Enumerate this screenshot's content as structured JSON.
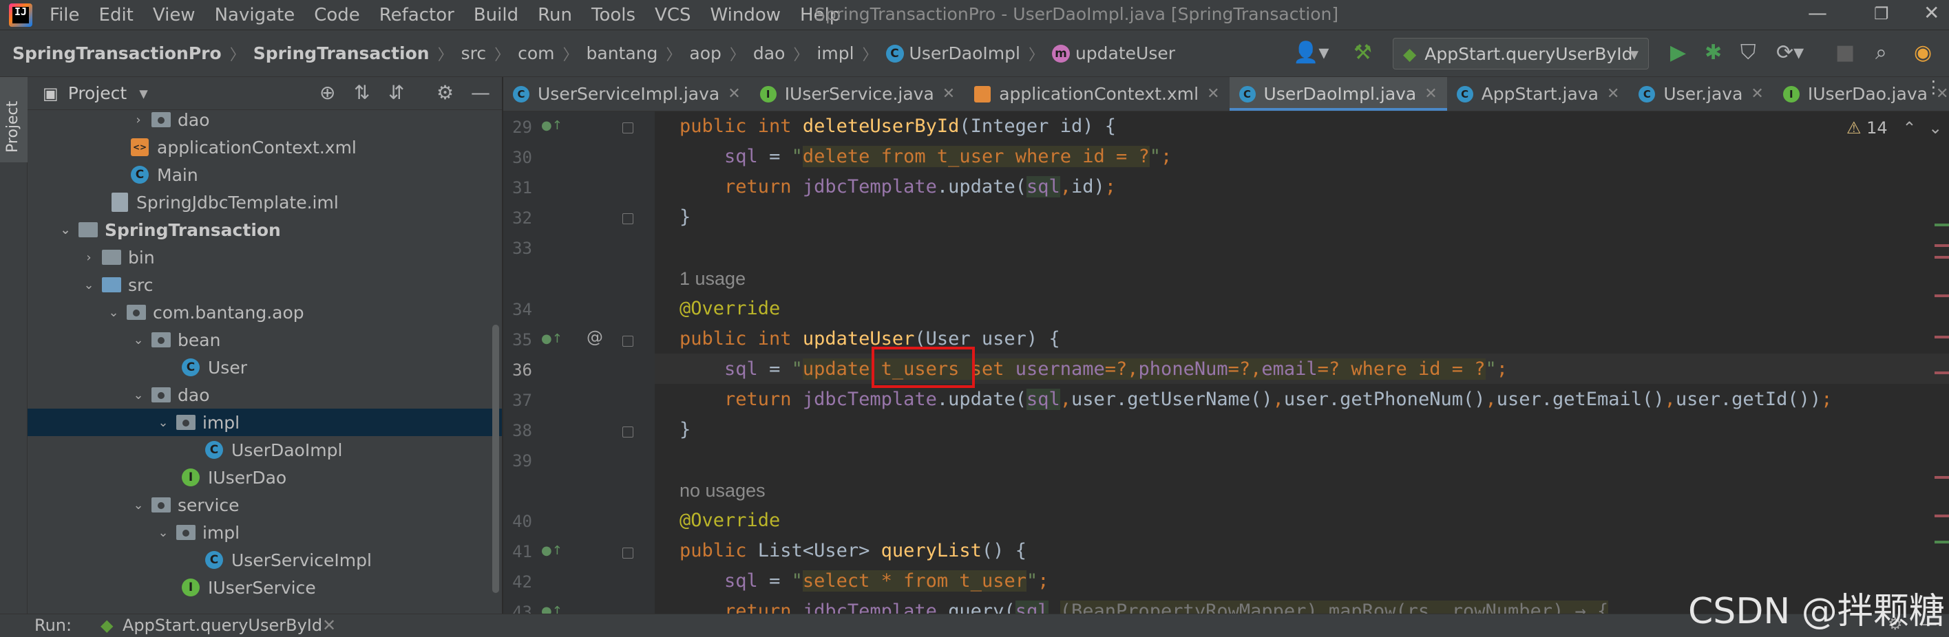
{
  "menubar": {
    "logo_text": "IJ",
    "items": [
      "File",
      "Edit",
      "View",
      "Navigate",
      "Code",
      "Refactor",
      "Build",
      "Run",
      "Tools",
      "VCS",
      "Window",
      "Help"
    ],
    "window_title": "SpringTransactionPro - UserDaoImpl.java [SpringTransaction]",
    "controls": {
      "minimize": "—",
      "maximize": "❐",
      "close": "✕"
    }
  },
  "navbar": {
    "crumbs": [
      "SpringTransactionPro",
      "SpringTransaction",
      "src",
      "com",
      "bantang",
      "aop",
      "dao",
      "impl",
      "UserDaoImpl",
      "updateUser"
    ],
    "run_config": "AppStart.queryUserById"
  },
  "left_stripe": {
    "label": "Project"
  },
  "project_panel": {
    "title": "Project",
    "tree": [
      {
        "label": "dao",
        "type": "package",
        "expanded": false
      },
      {
        "label": "applicationContext.xml",
        "type": "xml"
      },
      {
        "label": "Main",
        "type": "class"
      },
      {
        "label": "SpringJdbcTemplate.iml",
        "type": "iml"
      },
      {
        "label": "SpringTransaction",
        "type": "module",
        "expanded": true
      },
      {
        "label": "bin",
        "type": "folder",
        "expanded": false
      },
      {
        "label": "src",
        "type": "source",
        "expanded": true
      },
      {
        "label": "com.bantang.aop",
        "type": "package",
        "expanded": true
      },
      {
        "label": "bean",
        "type": "package",
        "expanded": true
      },
      {
        "label": "User",
        "type": "class"
      },
      {
        "label": "dao",
        "type": "package",
        "expanded": true
      },
      {
        "label": "impl",
        "type": "package",
        "expanded": true,
        "selected": true
      },
      {
        "label": "UserDaoImpl",
        "type": "class"
      },
      {
        "label": "IUserDao",
        "type": "interface"
      },
      {
        "label": "service",
        "type": "package",
        "expanded": true
      },
      {
        "label": "impl",
        "type": "package",
        "expanded": true
      },
      {
        "label": "UserServiceImpl",
        "type": "class"
      },
      {
        "label": "IUserService",
        "type": "interface"
      }
    ]
  },
  "editor_tabs": [
    {
      "label": "UserServiceImpl.java",
      "icon": "class"
    },
    {
      "label": "IUserService.java",
      "icon": "interface"
    },
    {
      "label": "applicationContext.xml",
      "icon": "xml"
    },
    {
      "label": "UserDaoImpl.java",
      "icon": "class",
      "active": true
    },
    {
      "label": "AppStart.java",
      "icon": "class"
    },
    {
      "label": "User.java",
      "icon": "class"
    },
    {
      "label": "IUserDao.java",
      "icon": "interface"
    }
  ],
  "editor": {
    "warnings_count": "14",
    "hints": {
      "usage_1": "1 usage",
      "no_usages": "no usages"
    },
    "line_numbers": [
      "29",
      "30",
      "31",
      "32",
      "33",
      "34",
      "35",
      "36",
      "37",
      "38",
      "39",
      "40",
      "41",
      "42",
      "43"
    ]
  },
  "bottom_bar": {
    "label": "Run:",
    "run_config": "AppStart.queryUserById"
  },
  "watermark": "CSDN @拌颗糖"
}
